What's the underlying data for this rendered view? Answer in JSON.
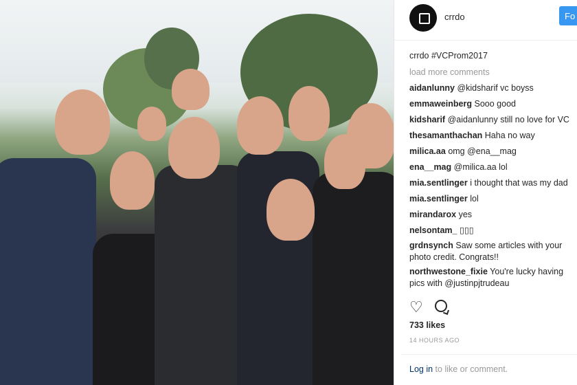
{
  "post": {
    "username": "crrdo",
    "follow_label": "Fo",
    "caption_user": "crrdo",
    "caption_text": "#VCProm2017",
    "load_more": "load more comments",
    "comments": [
      {
        "user": "aidanlunny",
        "text": "@kidsharif vc boyss"
      },
      {
        "user": "emmaweinberg",
        "text": "Sooo good"
      },
      {
        "user": "kidsharif",
        "text": "@aidanlunny still no love for VC"
      },
      {
        "user": "thesamanthachan",
        "text": "Haha no way"
      },
      {
        "user": "milica.aa",
        "text": "omg @ena__mag"
      },
      {
        "user": "ena__mag",
        "text": "@milica.aa lol"
      },
      {
        "user": "mia.sentlinger",
        "text": "i thought that was my dad"
      },
      {
        "user": "mia.sentlinger",
        "text": "lol"
      },
      {
        "user": "mirandarox",
        "text": "yes"
      },
      {
        "user": "nelsontam_",
        "text": "▯▯▯"
      },
      {
        "user": "grdnsynch",
        "text": "Saw some articles with your photo credit. Congrats!!"
      },
      {
        "user": "northwestone_fixie",
        "text": "You're lucky having pics with @justinpjtrudeau"
      }
    ],
    "likes": "733 likes",
    "time": "14 HOURS AGO",
    "login_link": "Log in",
    "login_rest": "to like or comment."
  },
  "icons": {
    "heart": "heart-icon",
    "comment": "comment-icon",
    "avatar": "brand-cube-icon"
  },
  "colors": {
    "follow": "#3897f0",
    "text": "#262626",
    "muted": "#999999"
  }
}
